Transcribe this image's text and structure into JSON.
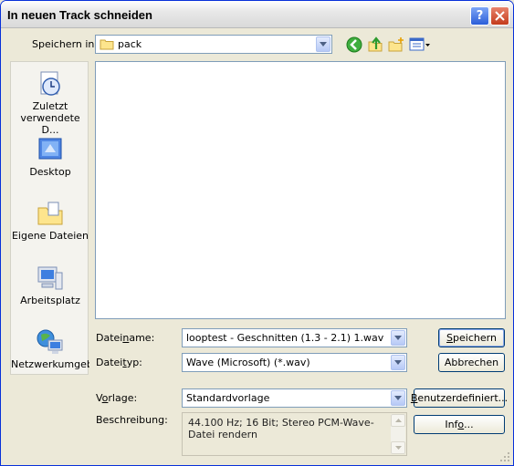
{
  "window": {
    "title": "In neuen Track schneiden"
  },
  "lookin": {
    "label": "Speichern in:",
    "folder": "pack"
  },
  "places": [
    {
      "label": "Zuletzt\nverwendete D...",
      "icon": "recent-documents-icon"
    },
    {
      "label": "Desktop",
      "icon": "desktop-icon"
    },
    {
      "label": "Eigene Dateien",
      "icon": "my-documents-icon"
    },
    {
      "label": "Arbeitsplatz",
      "icon": "my-computer-icon"
    },
    {
      "label": "Netzwerkumgeb",
      "icon": "network-places-icon"
    }
  ],
  "filename": {
    "label_pre": "Datei",
    "label_u": "n",
    "label_post": "ame:",
    "value": "looptest - Geschnitten (1.3 - 2.1) 1.wav"
  },
  "filetype": {
    "label_pre": "Datei",
    "label_u": "t",
    "label_post": "yp:",
    "value": "Wave (Microsoft) (*.wav)"
  },
  "template": {
    "label_pre": "V",
    "label_u": "o",
    "label_post": "rlage:",
    "value": "Standardvorlage"
  },
  "description": {
    "label": "Beschreibung:",
    "text": "44.100 Hz; 16 Bit; Stereo PCM-Wave-Datei rendern"
  },
  "buttons": {
    "save": {
      "u": "S",
      "rest": "peichern"
    },
    "cancel": "Abbrechen",
    "custom": {
      "u": "B",
      "rest": "enutzerdefiniert..."
    },
    "info": {
      "pre": "Inf",
      "u": "o",
      "post": "..."
    }
  }
}
